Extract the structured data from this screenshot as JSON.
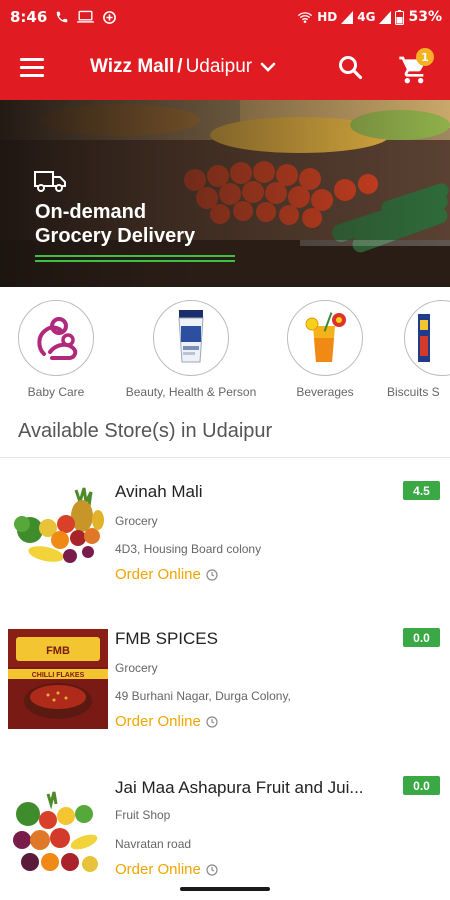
{
  "status_bar": {
    "time": "8:46",
    "network": "HD",
    "signal": "4G",
    "battery": "53%"
  },
  "app_bar": {
    "mall_name": "Wizz Mall",
    "separator": "/",
    "city": "Udaipur",
    "cart_count": "1",
    "accent_color": "#e11b22"
  },
  "banner": {
    "title": "On-demand",
    "subtitle": "Grocery Delivery"
  },
  "categories": [
    {
      "label": "Baby Care",
      "icon": "baby-care-icon"
    },
    {
      "label": "Beauty, Health & Person",
      "icon": "beauty-tube-icon"
    },
    {
      "label": "Beverages",
      "icon": "beverage-glass-icon"
    },
    {
      "label": "Biscuits S",
      "icon": "biscuit-pack-icon"
    }
  ],
  "section_title": "Available Store(s) in Udaipur",
  "stores": [
    {
      "name": "Avinah Mali",
      "category": "Grocery",
      "address": "4D3, Housing Board colony",
      "order_label": "Order Online",
      "rating": "4.5",
      "image": "fruits-vegetables-image"
    },
    {
      "name": "FMB SPICES",
      "category": "Grocery",
      "address": "49 Burhani Nagar, Durga Colony,",
      "order_label": "Order Online",
      "rating": "0.0",
      "image": "chilli-flakes-pack-image"
    },
    {
      "name": "Jai Maa Ashapura Fruit and Jui...",
      "category": "Fruit Shop",
      "address": "Navratan road",
      "order_label": "Order Online",
      "rating": "0.0",
      "image": "fruit-basket-image"
    }
  ]
}
